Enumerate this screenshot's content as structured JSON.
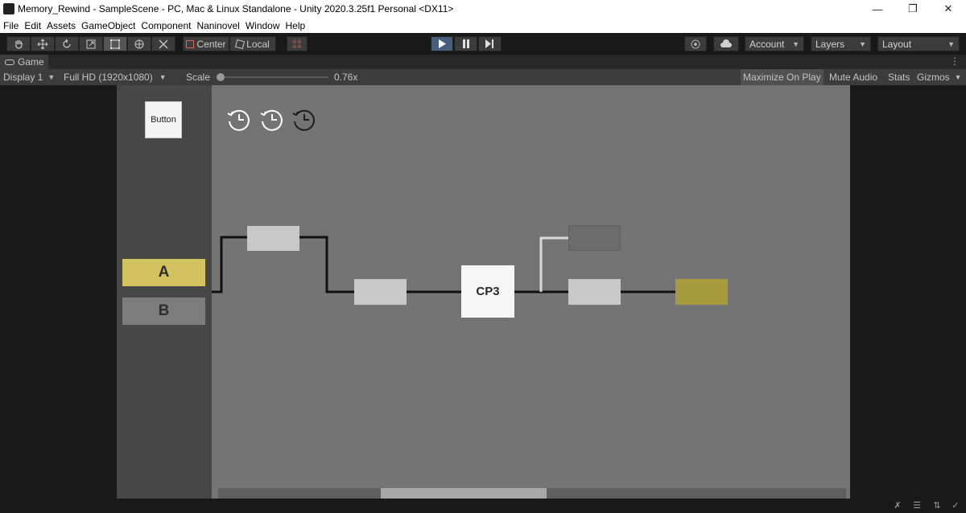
{
  "window": {
    "title": "Memory_Rewind - SampleScene - PC, Mac & Linux Standalone - Unity 2020.3.25f1 Personal <DX11>",
    "controls": [
      "minimize-icon",
      "restore-icon",
      "close-icon"
    ]
  },
  "menu": {
    "items": [
      "File",
      "Edit",
      "Assets",
      "GameObject",
      "Component",
      "Naninovel",
      "Window",
      "Help"
    ]
  },
  "toolbar": {
    "tools": [
      "hand-icon",
      "move-icon",
      "rotate-icon",
      "scale-icon",
      "rect-icon",
      "transform-icon",
      "custom-tool-icon"
    ],
    "pivot_label": "Center",
    "space_label": "Local",
    "snap_icon": "grid-snap-icon",
    "play_icon": "play-icon",
    "pause_icon": "pause-icon",
    "step_icon": "step-icon",
    "collab_icon": "collab-icon",
    "cloud_icon": "cloud-icon",
    "account_label": "Account",
    "layers_label": "Layers",
    "layout_label": "Layout",
    "colors": {
      "play_active": "#46607c"
    }
  },
  "tabs": {
    "game_label": "Game",
    "game_icon": "gamepad-icon"
  },
  "game_toolbar": {
    "display_label": "Display 1",
    "resolution_label": "Full HD (1920x1080)",
    "scale_label": "Scale",
    "scale_value": "0.76x",
    "maximize_label": "Maximize On Play",
    "mute_label": "Mute Audio",
    "stats_label": "Stats",
    "gizmos_label": "Gizmos"
  },
  "game_view": {
    "button_label": "Button",
    "rewind_icons": [
      "rewind-clock-icon",
      "rewind-clock-icon",
      "rewind-clock-icon"
    ],
    "choice_a": "A",
    "choice_b": "B",
    "checkpoint_label": "CP3",
    "colors": {
      "background": "#747474",
      "choice_a": "#d2c35e",
      "choice_b": "#7c7c7c",
      "goal": "#a89a3e"
    }
  },
  "status_icons": [
    "debug-off-icon",
    "layers-status-icon",
    "collab-status-icon",
    "check-icon"
  ]
}
